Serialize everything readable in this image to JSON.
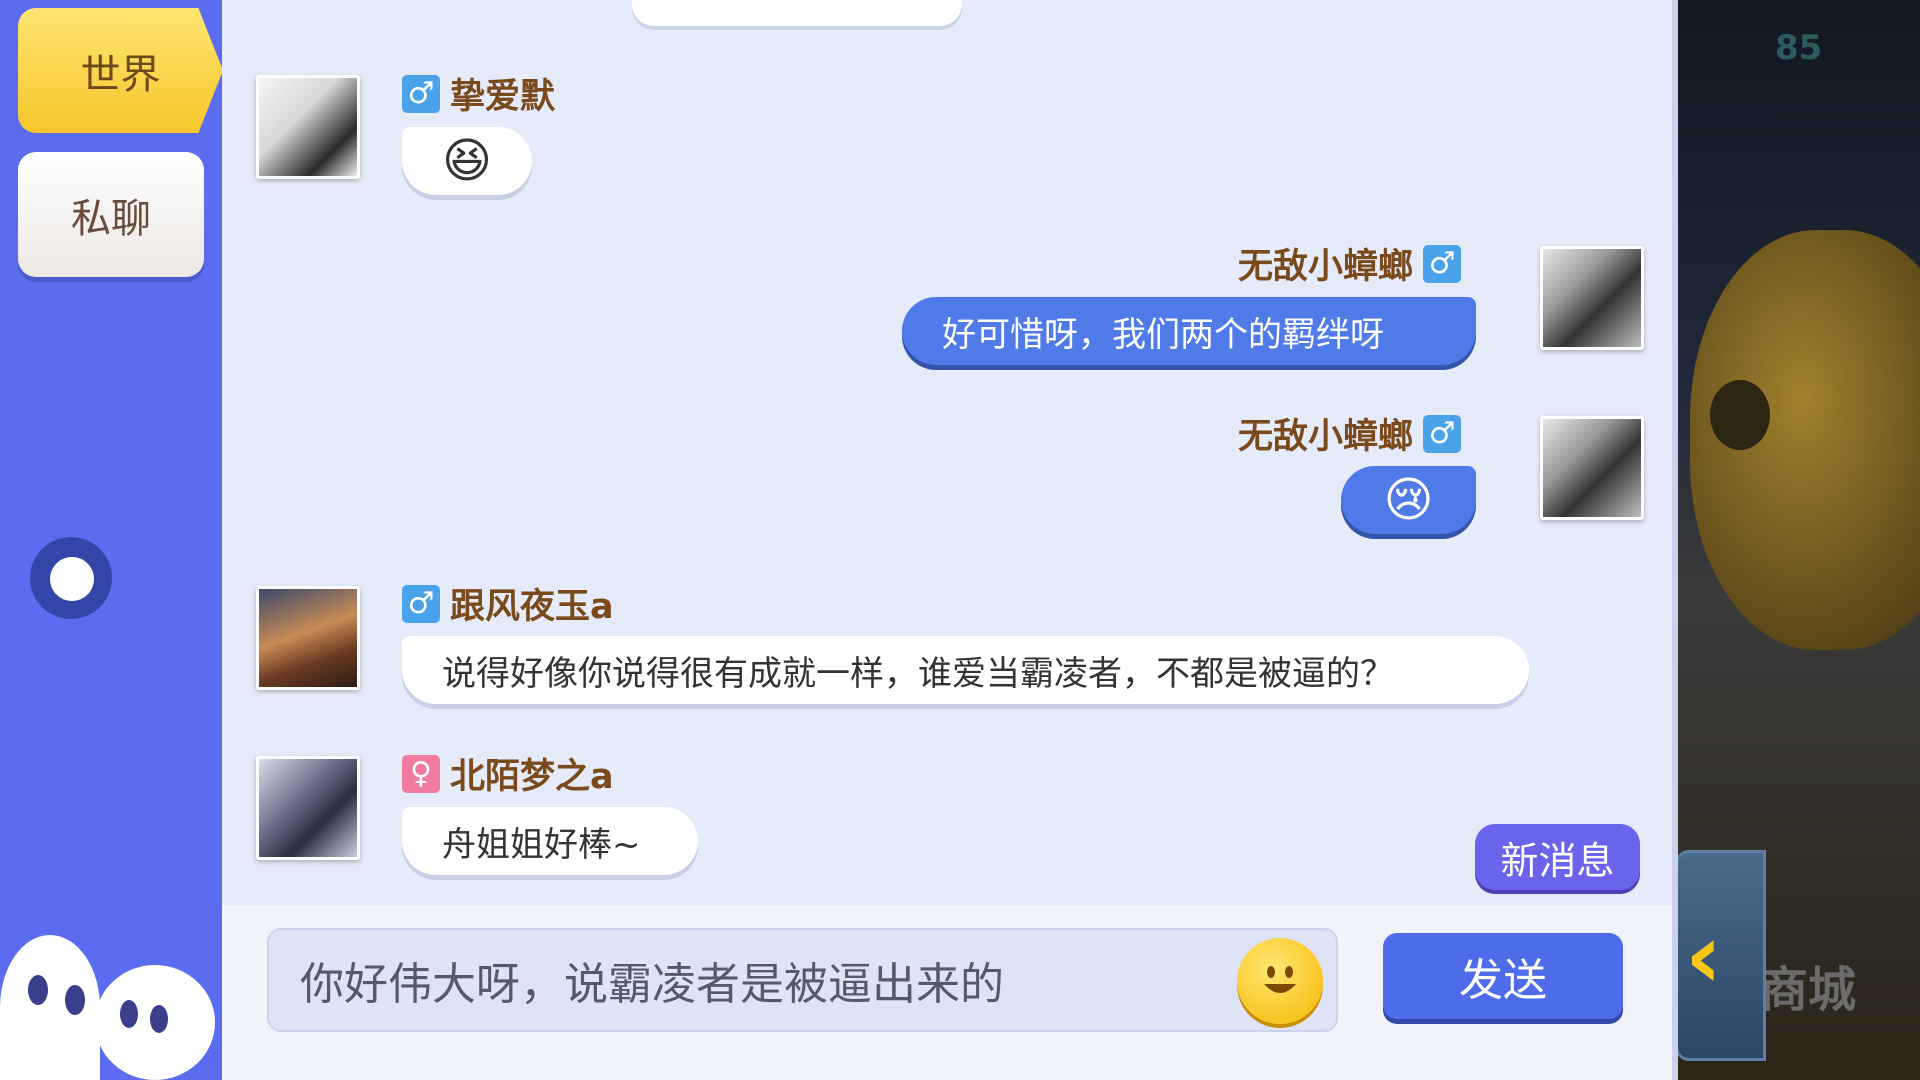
{
  "game": {
    "score": "85",
    "shop_label": "商城"
  },
  "sidebar": {
    "tabs": [
      {
        "label": "世界",
        "active": true
      },
      {
        "label": "私聊",
        "active": false
      }
    ]
  },
  "messages": [
    {
      "user": "挚爱默",
      "gender": "male",
      "side": "left",
      "content": "😆",
      "is_emoji": true
    },
    {
      "user": "无敌小蟑螂",
      "gender": "male",
      "side": "right",
      "content": "好可惜呀，我们两个的羁绊呀",
      "is_emoji": false
    },
    {
      "user": "无敌小蟑螂",
      "gender": "male",
      "side": "right",
      "content": "😢",
      "is_emoji": true
    },
    {
      "user": "跟风夜玉a",
      "gender": "male",
      "side": "left",
      "content": "说得好像你说得很有成就一样，谁爱当霸凌者，不都是被逼的？",
      "is_emoji": false
    },
    {
      "user": "北陌梦之a",
      "gender": "female",
      "side": "left",
      "content": "舟姐姐好棒~",
      "is_emoji": false
    }
  ],
  "gender_symbols": {
    "male": "♂",
    "female": "♀"
  },
  "new_message_label": "新消息",
  "input": {
    "value": "你好伟大呀，说霸凌者是被逼出来的"
  },
  "send_label": "发送",
  "colors": {
    "sidebar": "#5b6cf0",
    "active_tab": "#f6c62b",
    "bubble_self": "#4f7ae8",
    "bubble_other": "#ffffff",
    "send_button": "#4e6cea",
    "new_message": "#6a63ec"
  }
}
